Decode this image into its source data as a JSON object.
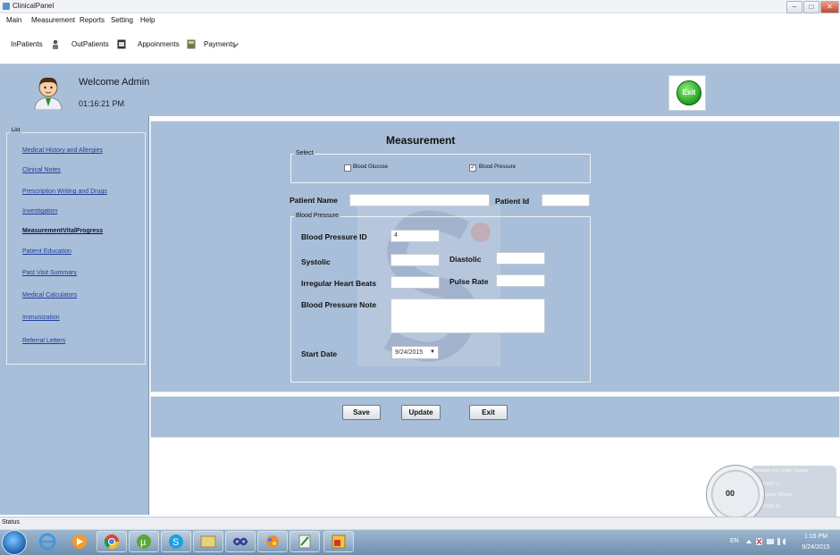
{
  "window": {
    "title": "ClinicalPanel"
  },
  "menu": [
    "Main",
    "Measurement",
    "Reports",
    "Setting",
    "Help"
  ],
  "toolbar": {
    "inpatients": "InPatients",
    "outpatients": "OutPatients",
    "appointments": "Appoinments",
    "payments": "Payments"
  },
  "header": {
    "welcome": "Welcome Admin",
    "clock": "01:16:21 PM",
    "exit_label": "Exit"
  },
  "sidebar": {
    "legend": "List",
    "items": [
      "Medical History and Allergies",
      "Clinical Notes",
      "Prescription Writing and Drugs",
      "Investigation",
      "MeasurementVitalProgress",
      "Patient Education",
      "Past Visit Summary",
      "Medical Calculators",
      "Immunization",
      "Referral Letters"
    ],
    "active_index": 4
  },
  "form": {
    "title": "Measurement",
    "select_legend": "Select",
    "options": [
      {
        "label": "Blood Glucose",
        "checked": false
      },
      {
        "label": "Blood Pressure",
        "checked": true
      }
    ],
    "patient_name_label": "Patient Name",
    "patient_name_value": "",
    "patient_id_label": "Patient Id",
    "patient_id_value": "",
    "bp_legend": "Blood Pressure",
    "bp_id_label": "Blood Pressure ID",
    "bp_id_value": "4",
    "systolic_label": "Systolic",
    "systolic_value": "",
    "diastolic_label": "Diastolic",
    "diastolic_value": "",
    "irregular_label": "Irregular Heart Beats",
    "irregular_value": "",
    "pulse_label": "Pulse Rate",
    "pulse_value": "",
    "note_label": "Blood Pressure Note",
    "note_value": "",
    "start_date_label": "Start Date",
    "start_date_value": "9/24/2015"
  },
  "buttons": {
    "save": "Save",
    "update": "Update",
    "exit": "Exit"
  },
  "status": {
    "text": "Status"
  },
  "gauge": {
    "value": "00",
    "title": "Network and Traffic Gadget",
    "line1": "PING: 0",
    "line2": "Speed: 0Kbit/s",
    "line3": "RAM: 15"
  },
  "taskbar": {
    "lang": "EN",
    "time": "1:16 PM",
    "date": "9/24/2015"
  },
  "colors": {
    "panel": "#a9bed8",
    "link": "#1f3f9a"
  }
}
